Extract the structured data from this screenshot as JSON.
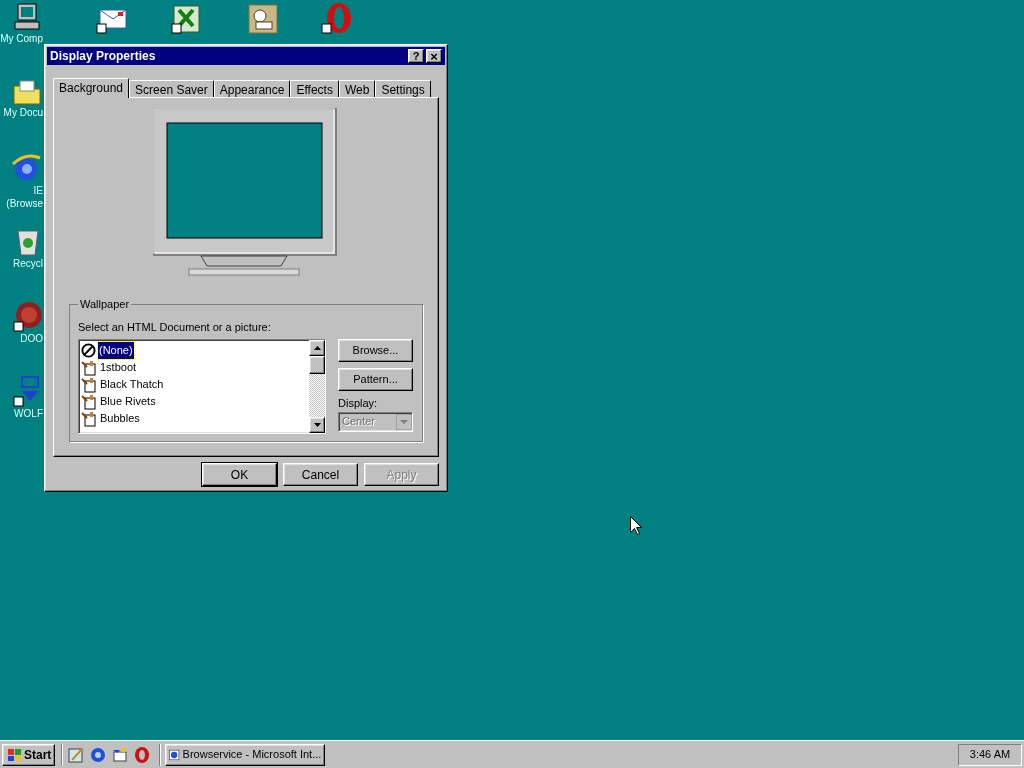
{
  "desktop_icons": [
    {
      "label": "My Comp",
      "kind": "computer"
    },
    {
      "label": "My Docu",
      "kind": "folder"
    },
    {
      "label": "IE\n(Browse",
      "kind": "browser"
    },
    {
      "label": "Recycl",
      "kind": "recycle"
    },
    {
      "label": "DOO",
      "kind": "game"
    },
    {
      "label": "WOLF",
      "kind": "shortcut"
    }
  ],
  "window": {
    "title": "Display Properties",
    "help": "?",
    "close": "×"
  },
  "tabs": [
    {
      "label": "Background",
      "selected": true
    },
    {
      "label": "Screen Saver",
      "selected": false
    },
    {
      "label": "Appearance",
      "selected": false
    },
    {
      "label": "Effects",
      "selected": false
    },
    {
      "label": "Web",
      "selected": false
    },
    {
      "label": "Settings",
      "selected": false
    }
  ],
  "wallpaper": {
    "group_label": "Wallpaper",
    "list_label": "Select an HTML Document or a picture:",
    "items": [
      {
        "label": "(None)",
        "kind": "none",
        "selected": true
      },
      {
        "label": "1stboot",
        "kind": "picture",
        "selected": false
      },
      {
        "label": "Black Thatch",
        "kind": "picture",
        "selected": false
      },
      {
        "label": "Blue Rivets",
        "kind": "picture",
        "selected": false
      },
      {
        "label": "Bubbles",
        "kind": "picture",
        "selected": false
      }
    ],
    "browse": "Browse...",
    "pattern": "Pattern...",
    "display_label": "Display:",
    "display": {
      "value": "Center",
      "disabled": true
    }
  },
  "buttons": [
    {
      "label": "OK",
      "disabled": false
    },
    {
      "label": "Cancel",
      "disabled": false
    },
    {
      "label": "Apply",
      "disabled": true
    }
  ],
  "taskbar": {
    "start": "Start",
    "task": "Browservice - Microsoft Int...",
    "clock": "3:46 AM"
  }
}
